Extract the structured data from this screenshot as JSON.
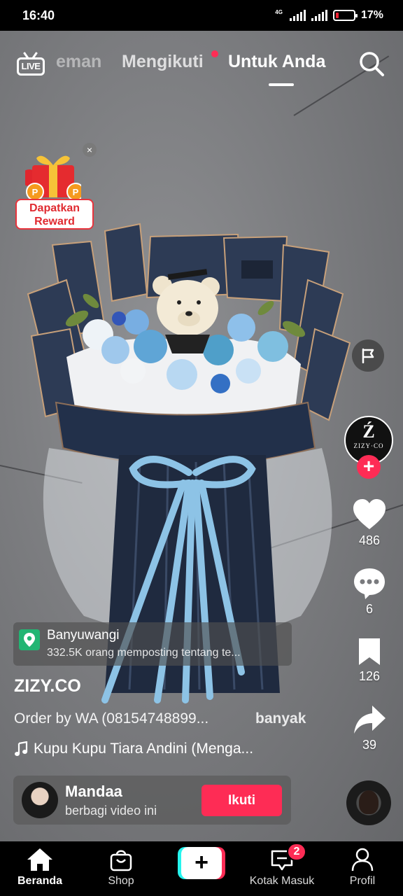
{
  "status_bar": {
    "time": "16:40",
    "network": "4G",
    "battery_percent_label": "17%",
    "battery_level": 0.17
  },
  "top_nav": {
    "live_label": "LIVE",
    "tabs": [
      {
        "label": "eman",
        "state": "partial"
      },
      {
        "label": "Mengikuti",
        "state": "inactive",
        "has_dot": true
      },
      {
        "label": "Untuk Anda",
        "state": "active"
      }
    ],
    "search_icon": "search-icon"
  },
  "reward": {
    "label_line1": "Dapatkan",
    "label_line2": "Reward",
    "close_glyph": "×"
  },
  "rail": {
    "creator_avatar_mono": "Ź",
    "creator_avatar_text": "ZIZY·CO",
    "likes": "486",
    "comments": "6",
    "saves": "126",
    "shares": "39"
  },
  "location": {
    "name": "Banyuwangi",
    "subtitle": "332.5K orang memposting tentang te..."
  },
  "post": {
    "author": "ZIZY.CO",
    "caption": "Order by WA (08154748899...",
    "caption_more": "banyak",
    "music": "Kupu Kupu Tiara Andini (Menga..."
  },
  "share_card": {
    "name": "Mandaa",
    "subtitle": "berbagi video ini",
    "follow_label": "Ikuti"
  },
  "tabbar": {
    "home": "Beranda",
    "shop": "Shop",
    "create": "+",
    "inbox": "Kotak Masuk",
    "inbox_badge": "2",
    "profile": "Profil"
  },
  "colors": {
    "accent": "#fe2c55",
    "cyan": "#25f4ee",
    "location_pin": "#22b573"
  }
}
